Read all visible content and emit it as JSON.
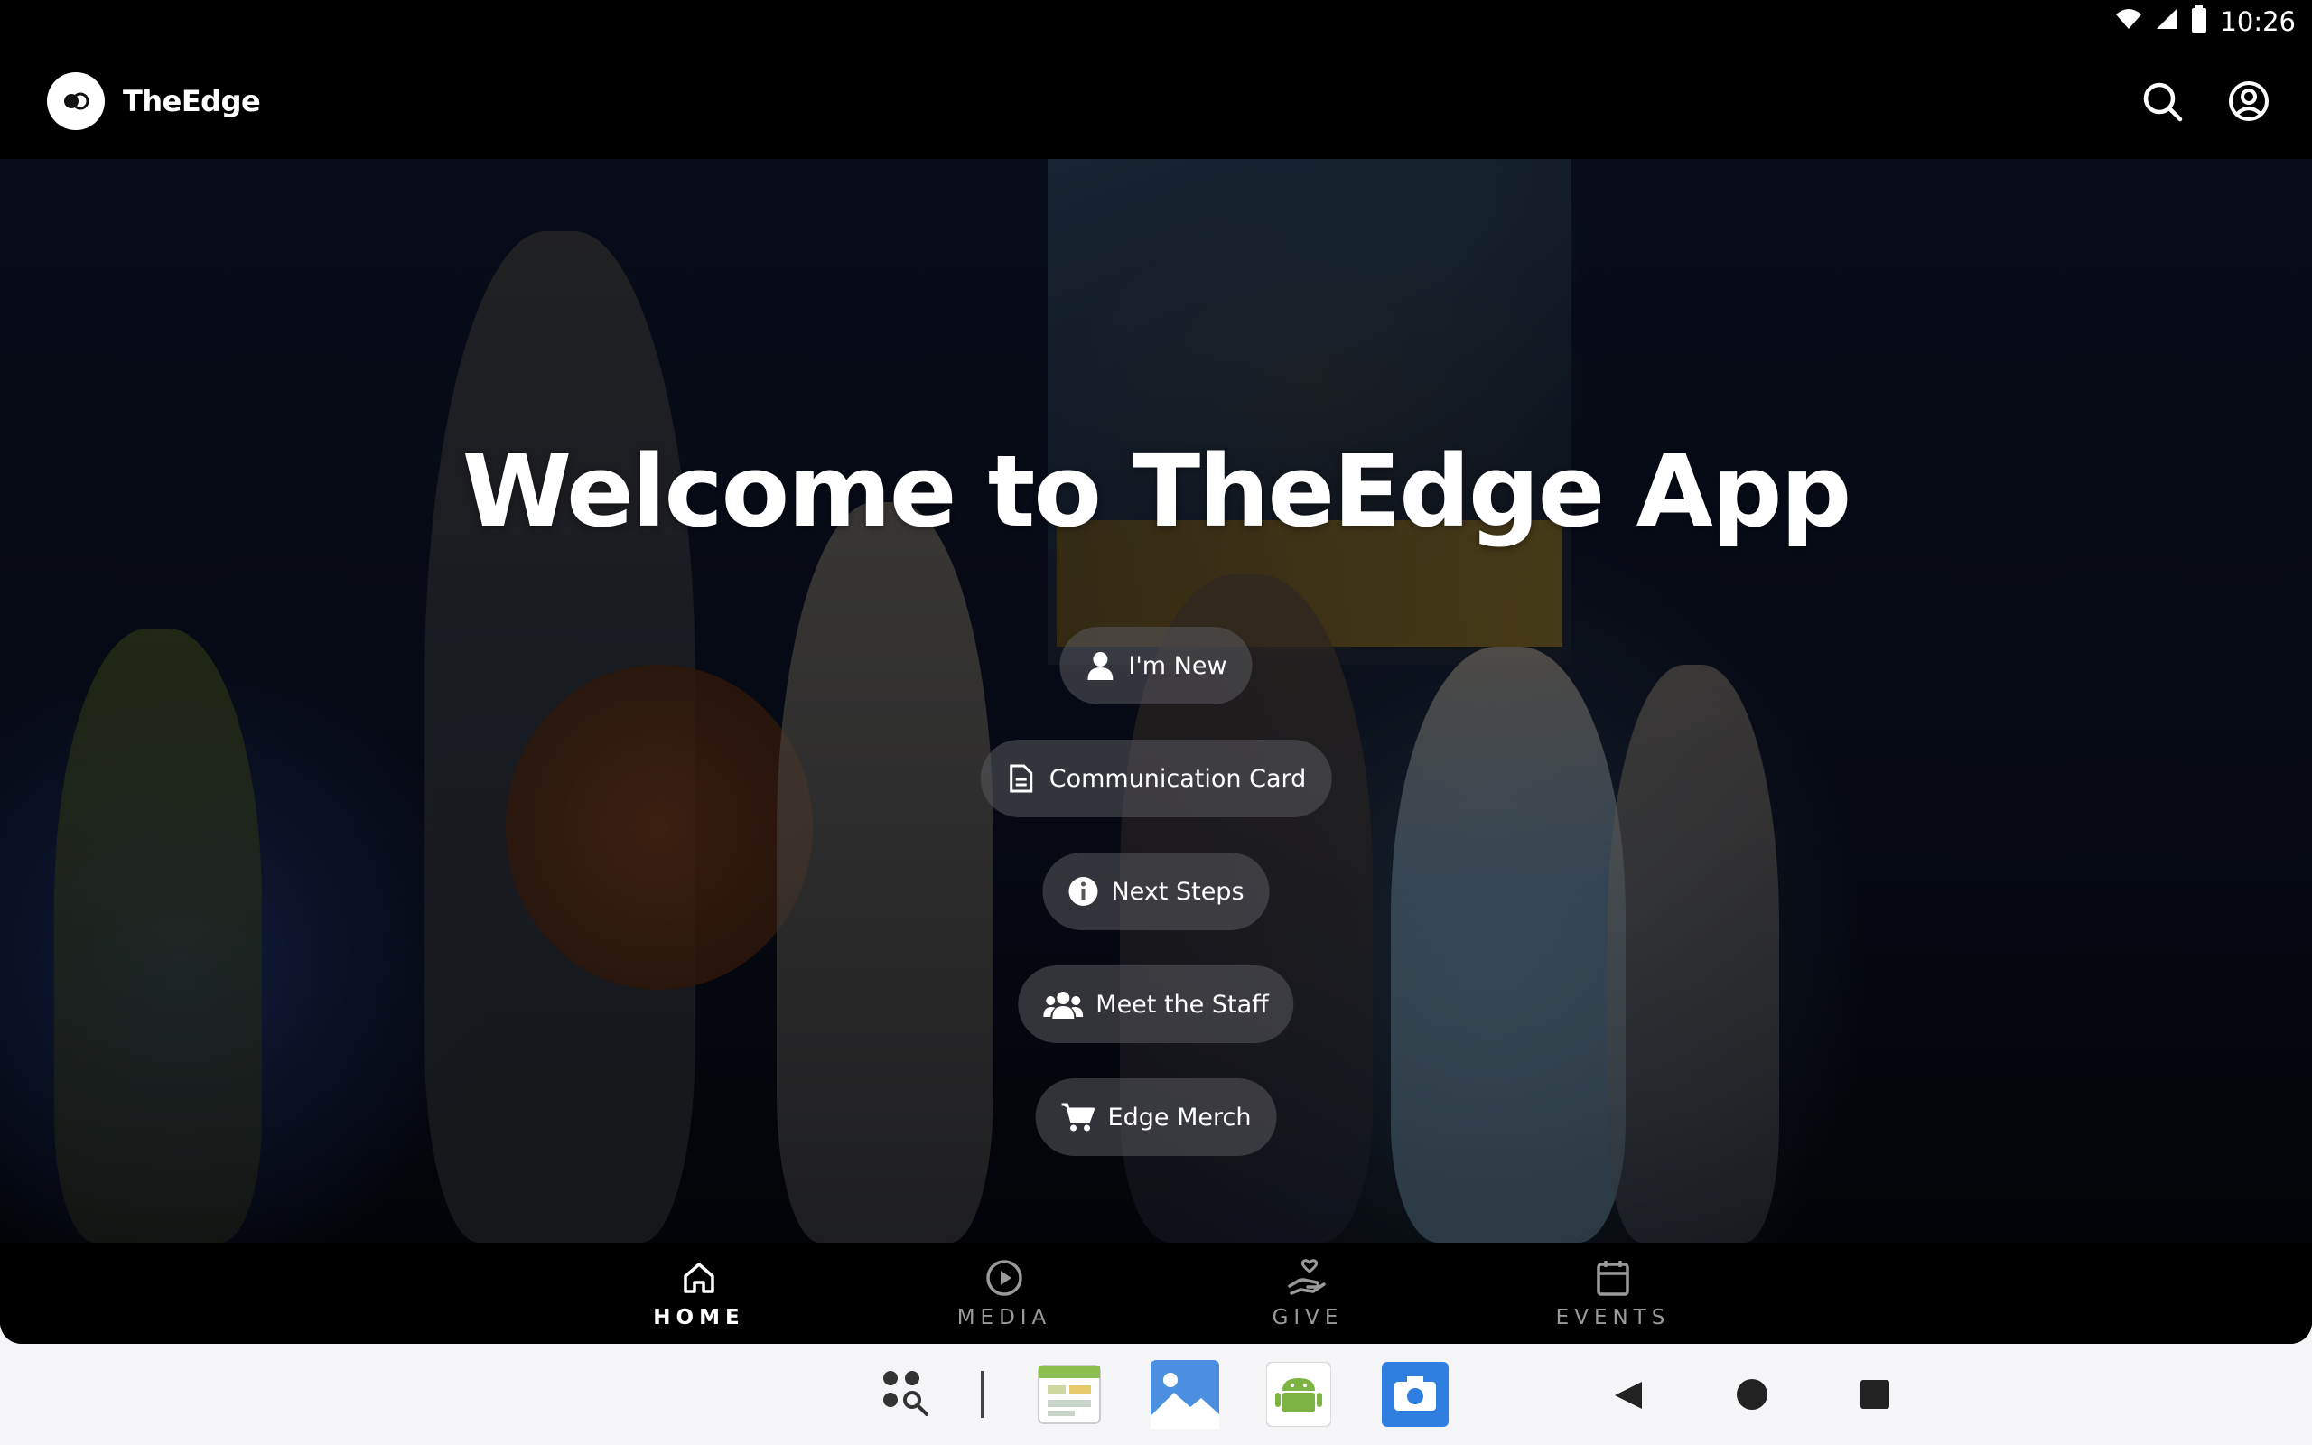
{
  "status_bar": {
    "time": "10:26"
  },
  "app_bar": {
    "brand": "TheEdge"
  },
  "hero": {
    "title": "Welcome to TheEdge App"
  },
  "actions": [
    {
      "label": "I'm New",
      "icon": "person-icon"
    },
    {
      "label": "Communication Card",
      "icon": "document-icon"
    },
    {
      "label": "Next Steps",
      "icon": "info-icon"
    },
    {
      "label": "Meet the Staff",
      "icon": "group-icon"
    },
    {
      "label": "Edge Merch",
      "icon": "cart-icon"
    }
  ],
  "bottom_nav": [
    {
      "label": "HOME",
      "icon": "home-icon",
      "active": true
    },
    {
      "label": "MEDIA",
      "icon": "play-circle-icon",
      "active": false
    },
    {
      "label": "GIVE",
      "icon": "give-hand-icon",
      "active": false
    },
    {
      "label": "EVENTS",
      "icon": "calendar-icon",
      "active": false
    }
  ],
  "taskbar": {
    "apps": [
      "app-drawer-icon",
      "calendar-app-icon",
      "gallery-app-icon",
      "android-app-icon",
      "camera-app-icon"
    ],
    "nav": [
      "back-icon",
      "home-circle-icon",
      "recents-icon"
    ]
  },
  "colors": {
    "accent": "#ffffff",
    "pill_bg": "#5a5a5f",
    "nav_inactive": "#9a9a9a"
  }
}
